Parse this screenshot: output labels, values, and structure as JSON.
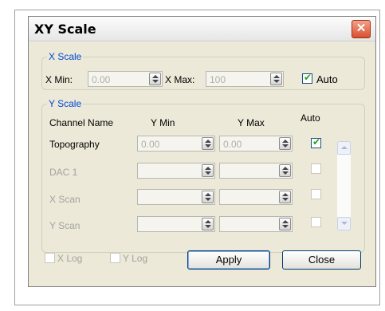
{
  "dialog": {
    "title": "XY Scale"
  },
  "x_scale": {
    "legend": "X Scale",
    "xmin_label": "X Min:",
    "xmin_value": "0.00",
    "xmax_label": "X Max:",
    "xmax_value": "100",
    "auto_label": "Auto",
    "auto_checked": true
  },
  "y_scale": {
    "legend": "Y Scale",
    "headers": {
      "channel": "Channel Name",
      "ymin": "Y Min",
      "ymax": "Y Max",
      "auto": "Auto"
    },
    "rows": [
      {
        "name": "Topography",
        "ymin": "0.00",
        "ymax": "0.00",
        "auto": true,
        "enabled": true
      },
      {
        "name": "DAC 1",
        "ymin": "",
        "ymax": "",
        "auto": false,
        "enabled": false
      },
      {
        "name": "X Scan",
        "ymin": "",
        "ymax": "",
        "auto": false,
        "enabled": false
      },
      {
        "name": "Y Scan",
        "ymin": "",
        "ymax": "",
        "auto": false,
        "enabled": false
      }
    ]
  },
  "footer": {
    "xlog_label": "X Log",
    "ylog_label": "Y Log",
    "apply_label": "Apply",
    "close_label": "Close"
  }
}
